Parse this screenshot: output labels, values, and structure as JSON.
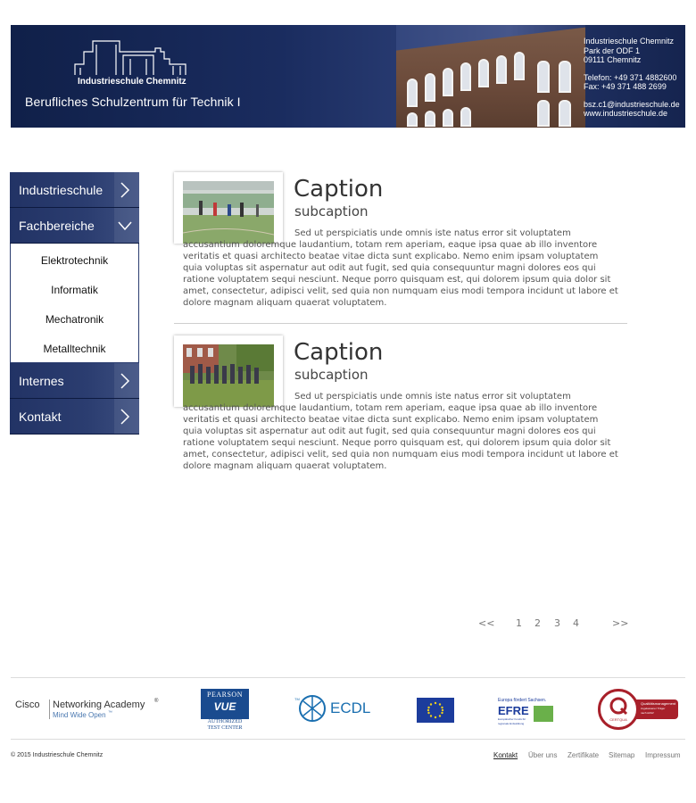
{
  "header": {
    "logo_text": "Industrieschule Chemnitz",
    "title": "Berufliches Schulzentrum für Technik I",
    "contact": {
      "name": "Industrieschule Chemnitz",
      "street": "Park der ODF 1",
      "city": "09111 Chemnitz",
      "phone": "Telefon: +49 371 4882600",
      "fax": "Fax: +49 371 488 2699",
      "email": "bsz.c1@industrieschule.de",
      "web": "www.industrieschule.de"
    }
  },
  "sidebar": {
    "items": [
      {
        "label": "Industrieschule"
      },
      {
        "label": "Fachbereiche"
      },
      {
        "label": "Internes"
      },
      {
        "label": "Kontakt"
      }
    ],
    "subitems": [
      "Elektrotechnik",
      "Informatik",
      "Mechatronik",
      "Metalltechnik"
    ]
  },
  "articles": [
    {
      "caption": "Caption",
      "subcaption": "subcaption",
      "text": "Sed ut perspiciatis unde omnis iste natus error sit voluptatem accusantium doloremque laudantium, totam rem aperiam, eaque ipsa quae ab illo inventore veritatis et quasi architecto beatae vitae dicta sunt explicabo. Nemo enim ipsam voluptatem quia voluptas sit aspernatur aut odit aut fugit, sed quia consequuntur magni dolores eos qui ratione voluptatem sequi nesciunt. Neque porro quisquam est, qui dolorem ipsum quia dolor sit amet, consectetur, adipisci velit, sed quia non numquam eius modi tempora incidunt ut labore et dolore magnam aliquam quaerat voluptatem."
    },
    {
      "caption": "Caption",
      "subcaption": "subcaption",
      "text": "Sed ut perspiciatis unde omnis iste natus error sit voluptatem accusantium doloremque laudantium, totam rem aperiam, eaque ipsa quae ab illo inventore veritatis et quasi architecto beatae vitae dicta sunt explicabo. Nemo enim ipsam voluptatem quia voluptas sit aspernatur aut odit aut fugit, sed quia consequuntur magni dolores eos qui ratione voluptatem sequi nesciunt. Neque porro quisquam est, qui dolorem ipsum quia dolor sit amet, consectetur, adipisci velit, sed quia non numquam eius modi tempora incidunt ut labore et dolore magnam aliquam quaerat voluptatem."
    }
  ],
  "pagination": {
    "prev": "<<",
    "pages": [
      "1",
      "2",
      "3",
      "4"
    ],
    "next": ">>"
  },
  "logos": {
    "cisco": {
      "name": "Cisco",
      "program": "Networking Academy",
      "trademark": "®",
      "tagline": "Mind Wide Open",
      "tagline_tm": "™"
    },
    "pearson": {
      "top": "PEARSON",
      "mark": "VUE",
      "line1": "AUTHORIZED",
      "line2": "TEST CENTER"
    },
    "ecdl": {
      "tm": "TM",
      "text": "ECDL"
    },
    "efre": {
      "top": "Europa fördert Sachsen.",
      "mark": "EFRE",
      "sub1": "Europäischer Fonds für",
      "sub2": "regionale Entwicklung"
    },
    "certqua": {
      "seal": "CERTQUA",
      "text1": "Qualitätsmanagement",
      "text2": "zugelassener Träger",
      "text3": "nach AZAV"
    }
  },
  "footer": {
    "copyright": "© 2015 Industrieschule Chemnitz",
    "links": [
      "Kontakt",
      "Über uns",
      "Zertifikate",
      "Sitemap",
      "Impressum"
    ]
  },
  "colors": {
    "nav_dark": "#223365",
    "header_dark": "#102049",
    "text_gray": "#555555",
    "certqua_red": "#a8202a"
  }
}
